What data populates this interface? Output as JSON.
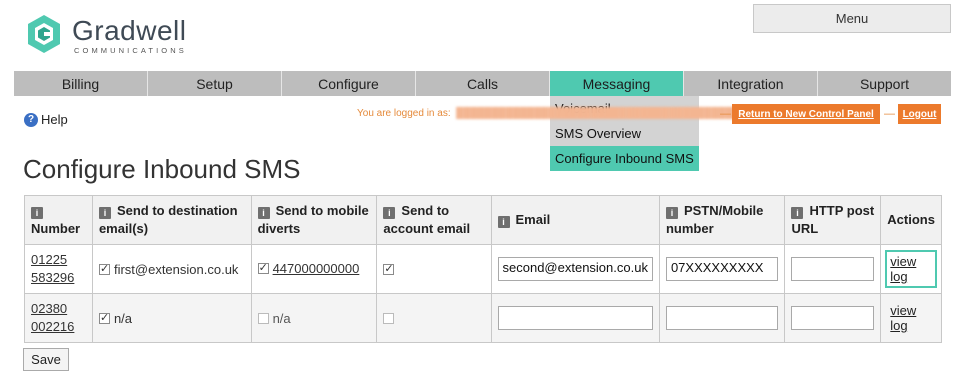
{
  "brand": {
    "name": "Gradwell",
    "tagline": "COMMUNICATIONS",
    "color": "#4fc9b0"
  },
  "header": {
    "menu_label": "Menu"
  },
  "nav": {
    "items": [
      "Billing",
      "Setup",
      "Configure",
      "Calls",
      "Messaging",
      "Integration",
      "Support"
    ],
    "active": "Messaging"
  },
  "dropdown": {
    "items": [
      "Voicemail",
      "SMS Overview",
      "Configure Inbound SMS"
    ],
    "active": "Configure Inbound SMS"
  },
  "help": {
    "icon": "help-icon",
    "label": "Help"
  },
  "session": {
    "logged_in_prefix": "You are logged in as:",
    "return_label": "Return to New Control Panel",
    "logout_label": "Logout",
    "dash": "—"
  },
  "page": {
    "title": "Configure Inbound SMS",
    "save_label": "Save"
  },
  "table": {
    "headers": {
      "number": "Number",
      "send_dest": "Send to destination email(s)",
      "send_mobile": "Send to mobile diverts",
      "send_account": "Send to account email",
      "email": "Email",
      "pstn": "PSTN/Mobile number",
      "http": "HTTP post URL",
      "actions": "Actions"
    },
    "rows": [
      {
        "number_line1": "01225",
        "number_line2": "583296",
        "dest": "first@extension.co.uk",
        "dest_checked": true,
        "mobile": "447000000000",
        "mobile_checked": true,
        "account_checked": true,
        "email": "second@extension.co.uk",
        "pstn": "07XXXXXXXXX",
        "http": "",
        "action": "view log"
      },
      {
        "number_line1": "02380",
        "number_line2": "002216",
        "dest": "n/a",
        "dest_checked": true,
        "mobile": "n/a",
        "mobile_checked": false,
        "account_checked": false,
        "email": "",
        "pstn": "",
        "http": "",
        "action": "view log"
      }
    ]
  }
}
